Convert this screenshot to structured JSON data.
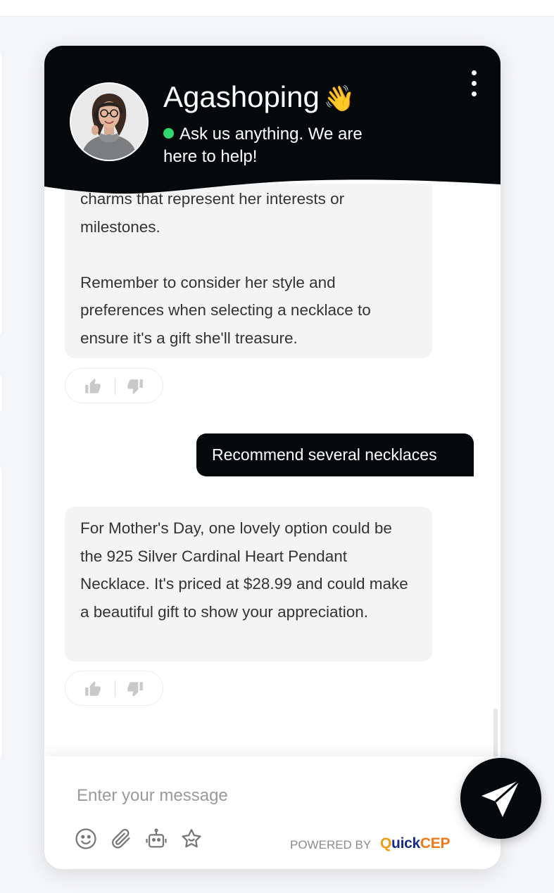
{
  "header": {
    "agent_name": "Agashoping",
    "wave_emoji": "👋",
    "status_text": "Ask us anything. We are here to help!",
    "status_color": "#2fd96d",
    "background_color": "#05090b",
    "menu_icon": "more-vertical-icon"
  },
  "messages": [
    {
      "role": "bot",
      "paragraphs": [
        "charms that represent her interests or milestones.",
        "Remember to consider her style and preferences when selecting a necklace to ensure it's a gift she'll treasure."
      ],
      "feedback": {
        "up_icon": "thumbs-up-icon",
        "down_icon": "thumbs-down-icon"
      }
    },
    {
      "role": "user",
      "text": "Recommend several necklaces"
    },
    {
      "role": "bot",
      "paragraphs": [
        "For Mother's Day, one lovely option could be the 925 Silver Cardinal Heart Pendant Necklace. It's priced at $28.99 and could make a beautiful gift to show your appreciation."
      ],
      "feedback": {
        "up_icon": "thumbs-up-icon",
        "down_icon": "thumbs-down-icon"
      }
    }
  ],
  "composer": {
    "placeholder": "Enter your message",
    "value": "",
    "tools": [
      "emoji-icon",
      "attachment-icon",
      "bot-icon",
      "star-badge-icon"
    ],
    "powered_by": "POWERED BY",
    "brand": {
      "q": "Q",
      "uick": "uick",
      "cep": "CEP"
    }
  },
  "send_button": {
    "icon": "send-icon"
  },
  "colors": {
    "accent": "#05090b",
    "bot_bubble": "#f4f4f4",
    "page_background": "#f5f6f8"
  }
}
